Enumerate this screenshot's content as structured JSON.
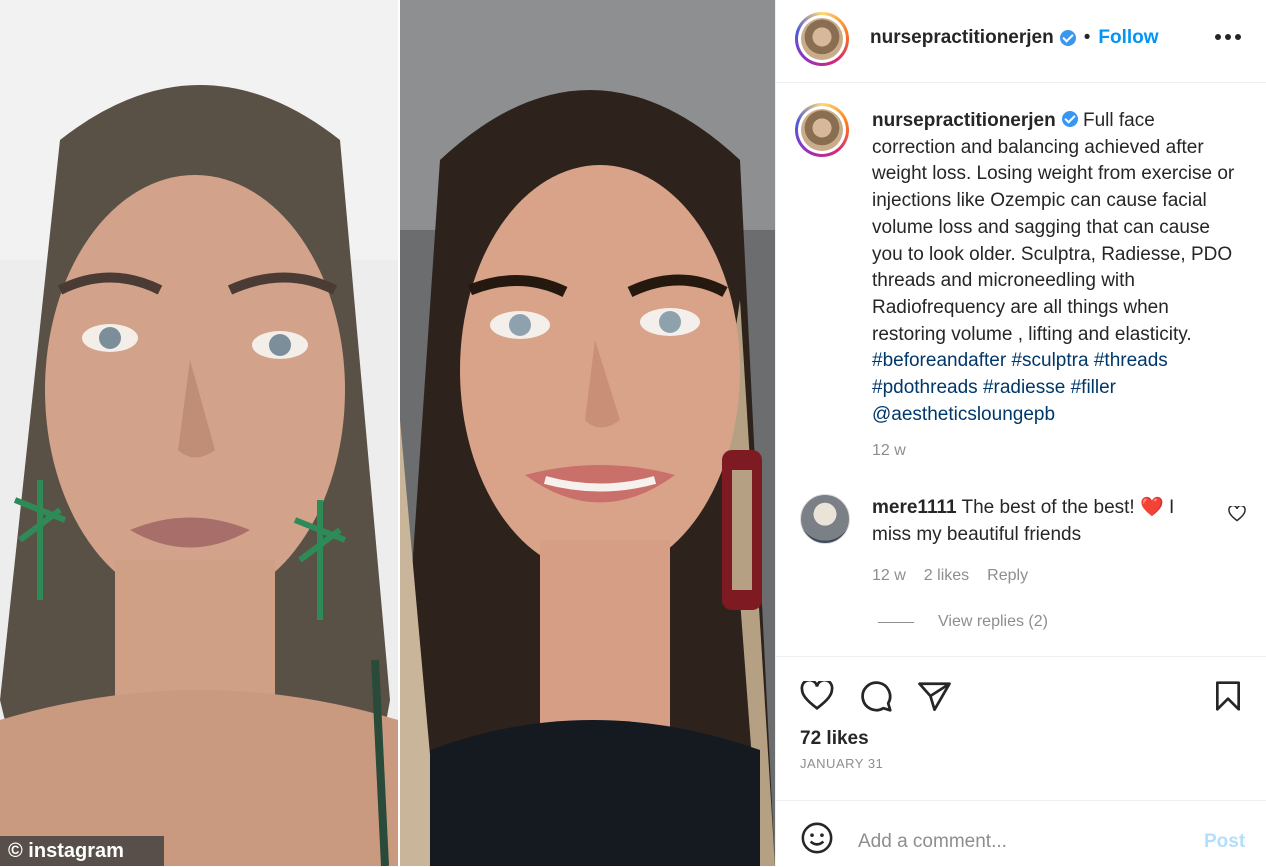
{
  "media": {
    "watermark": "© instagram"
  },
  "header": {
    "username": "nursepractitionerjen",
    "separator": "•",
    "follow_label": "Follow",
    "more_icon": "more-horizontal-icon"
  },
  "caption": {
    "username": "nursepractitionerjen",
    "text": "Full face correction and balancing achieved after weight loss. Losing weight from exercise or injections like Ozempic can cause facial volume loss and sagging that can cause you to look older. Sculptra, Radiesse, PDO threads and microneedling with Radiofrequency are all things when restoring volume , lifting and elasticity.",
    "hashtags": [
      "#beforeandafter",
      "#sculptra",
      "#threads",
      "#pdothreads",
      "#radiesse",
      "#filler"
    ],
    "mention": "@aestheticsloungepb",
    "age": "12 w"
  },
  "comment": {
    "username": "mere1111",
    "text_before": "The best of the best!",
    "emoji": "❤️",
    "text_after": "I miss my beautiful friends",
    "age": "12 w",
    "likes": "2 likes",
    "reply_label": "Reply",
    "view_replies": "View replies (2)"
  },
  "footer": {
    "likes": "72 likes",
    "date": "JANUARY 31",
    "comment_placeholder": "Add a comment...",
    "post_label": "Post"
  },
  "colors": {
    "link_blue": "#0095f6",
    "hashtag_blue": "#00376b",
    "muted": "#8e8e8e",
    "verified": "#3897f0"
  }
}
